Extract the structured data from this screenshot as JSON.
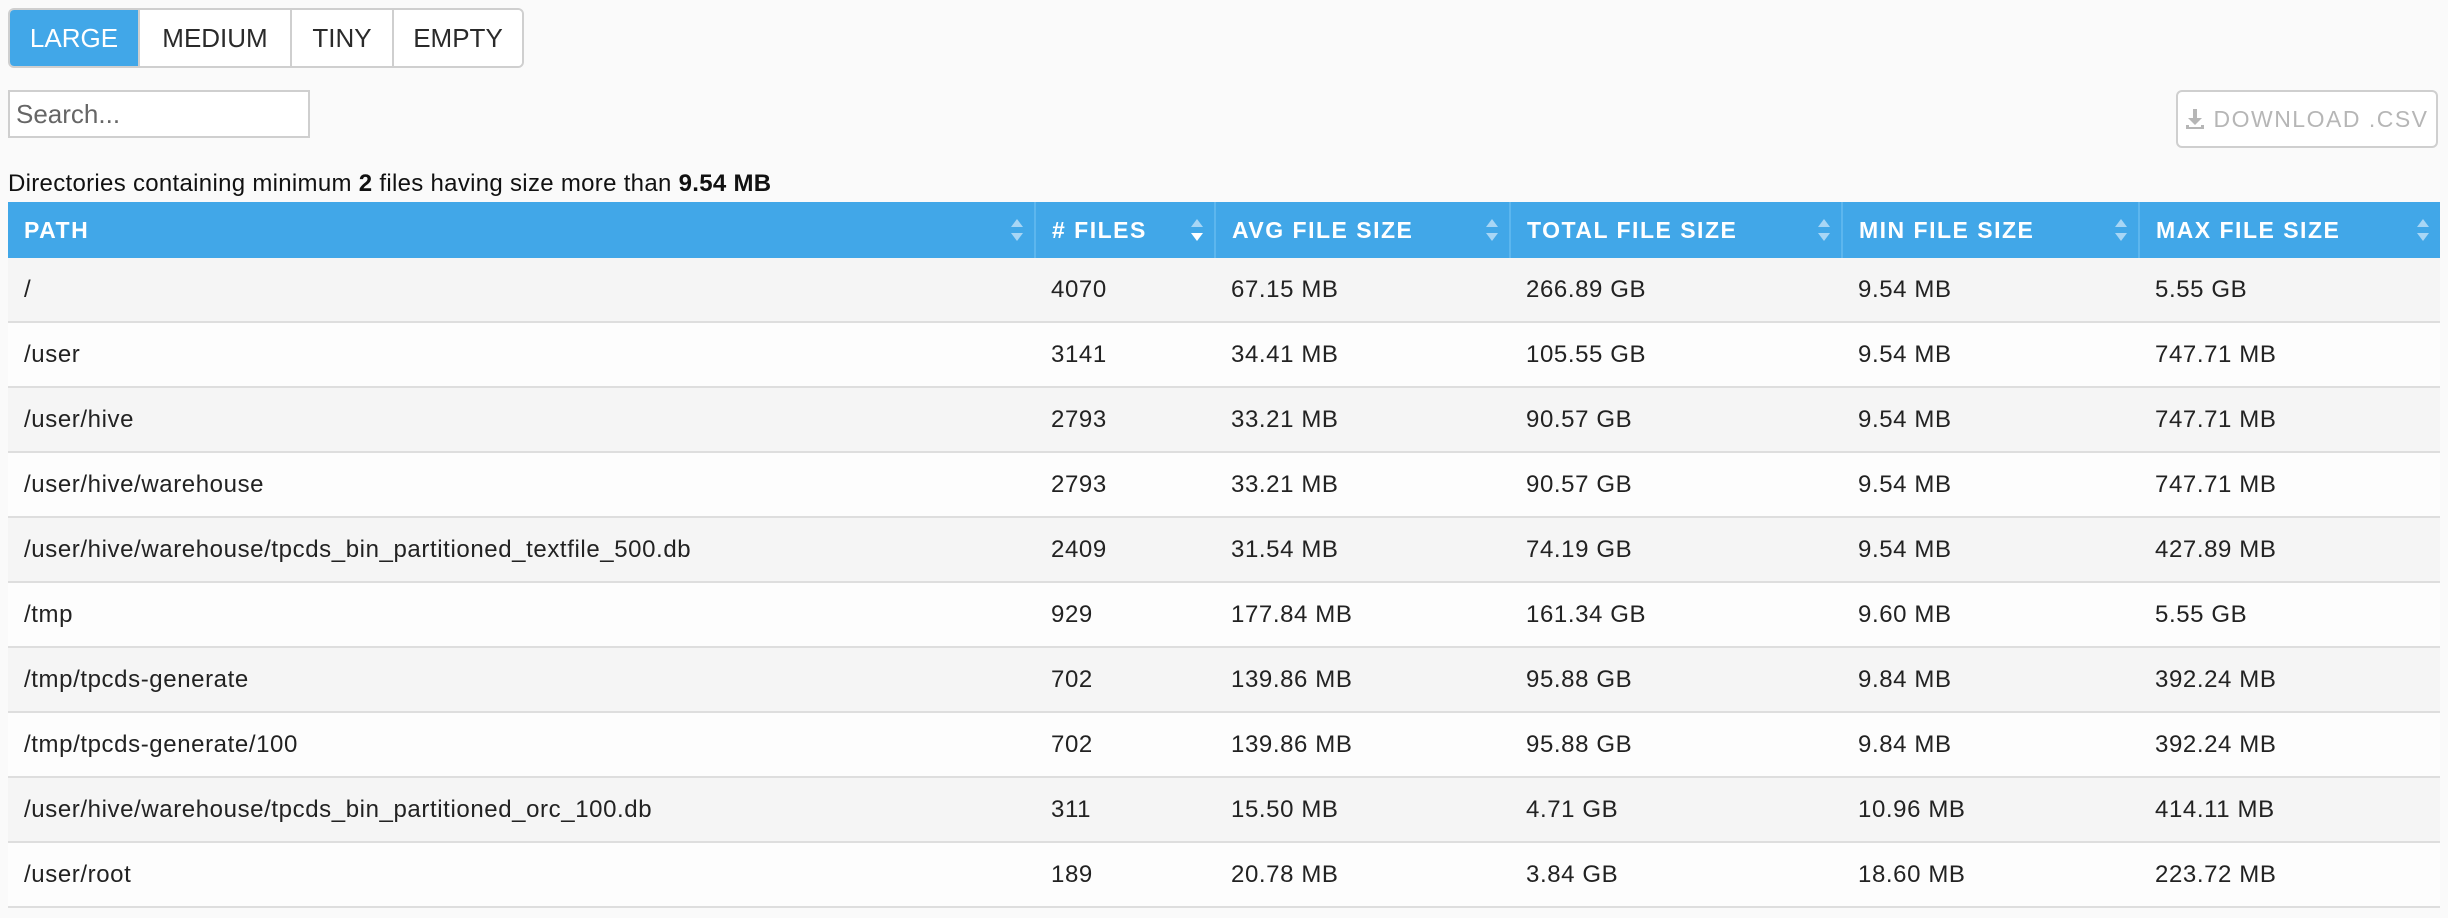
{
  "tabs": [
    {
      "label": "LARGE",
      "active": true
    },
    {
      "label": "MEDIUM",
      "active": false
    },
    {
      "label": "TINY",
      "active": false
    },
    {
      "label": "EMPTY",
      "active": false
    }
  ],
  "search": {
    "placeholder": "Search...",
    "value": ""
  },
  "download": {
    "label": "DOWNLOAD .CSV",
    "icon": "download-icon"
  },
  "description": {
    "prefix": "Directories containing minimum ",
    "min_files": "2",
    "middle": " files having size more than ",
    "min_size": "9.54 MB"
  },
  "table": {
    "columns": [
      "PATH",
      "# FILES",
      "AVG FILE SIZE",
      "TOTAL FILE SIZE",
      "MIN FILE SIZE",
      "MAX FILE SIZE"
    ],
    "rows": [
      [
        "/",
        "4070",
        "67.15 MB",
        "266.89 GB",
        "9.54 MB",
        "5.55 GB"
      ],
      [
        "/user",
        "3141",
        "34.41 MB",
        "105.55 GB",
        "9.54 MB",
        "747.71 MB"
      ],
      [
        "/user/hive",
        "2793",
        "33.21 MB",
        "90.57 GB",
        "9.54 MB",
        "747.71 MB"
      ],
      [
        "/user/hive/warehouse",
        "2793",
        "33.21 MB",
        "90.57 GB",
        "9.54 MB",
        "747.71 MB"
      ],
      [
        "/user/hive/warehouse/tpcds_bin_partitioned_textfile_500.db",
        "2409",
        "31.54 MB",
        "74.19 GB",
        "9.54 MB",
        "427.89 MB"
      ],
      [
        "/tmp",
        "929",
        "177.84 MB",
        "161.34 GB",
        "9.60 MB",
        "5.55 GB"
      ],
      [
        "/tmp/tpcds-generate",
        "702",
        "139.86 MB",
        "95.88 GB",
        "9.84 MB",
        "392.24 MB"
      ],
      [
        "/tmp/tpcds-generate/100",
        "702",
        "139.86 MB",
        "95.88 GB",
        "9.84 MB",
        "392.24 MB"
      ],
      [
        "/user/hive/warehouse/tpcds_bin_partitioned_orc_100.db",
        "311",
        "15.50 MB",
        "4.71 GB",
        "10.96 MB",
        "414.11 MB"
      ],
      [
        "/user/root",
        "189",
        "20.78 MB",
        "3.84 GB",
        "18.60 MB",
        "223.72 MB"
      ]
    ]
  },
  "colors": {
    "accent": "#41a7e8",
    "border": "#cfcfcf",
    "disabled_text": "#b6b6b6"
  }
}
